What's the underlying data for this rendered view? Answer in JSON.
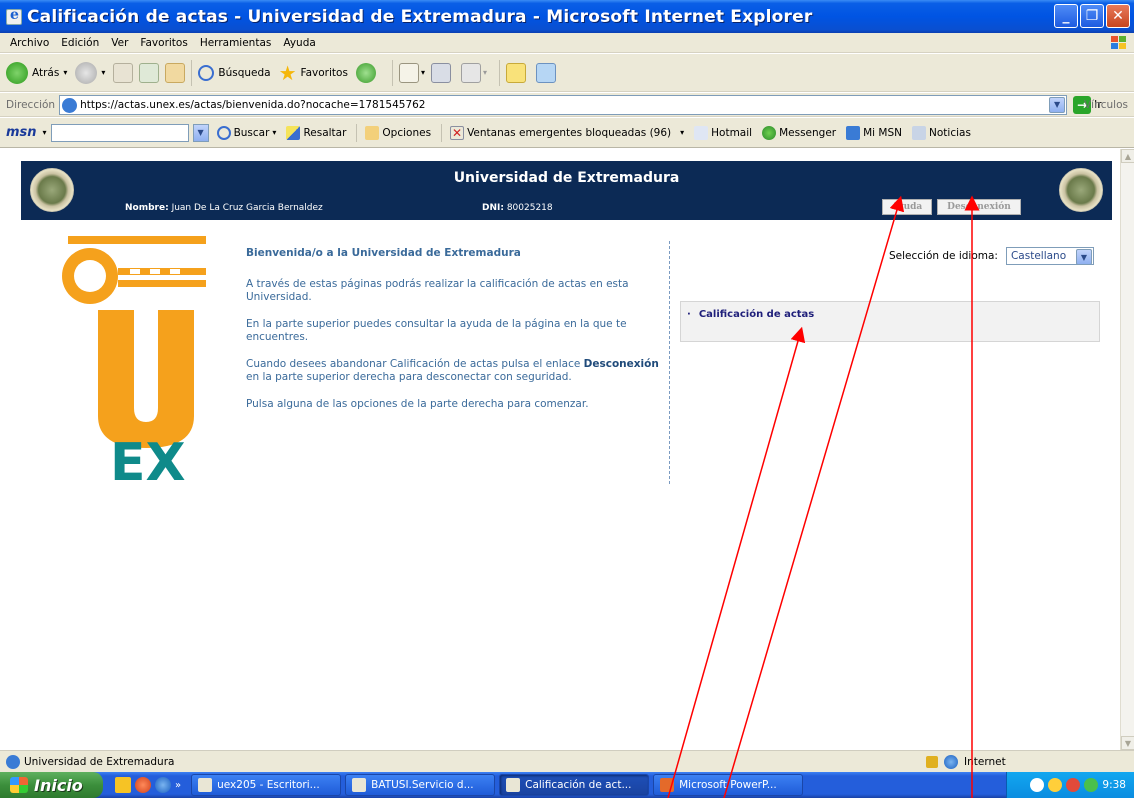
{
  "window": {
    "title": "Calificación de actas - Universidad de Extremadura - Microsoft Internet Explorer"
  },
  "menubar": [
    "Archivo",
    "Edición",
    "Ver",
    "Favoritos",
    "Herramientas",
    "Ayuda"
  ],
  "toolbar": {
    "back": "Atrás",
    "search": "Búsqueda",
    "favorites": "Favoritos"
  },
  "address": {
    "label": "Dirección",
    "url": "https://actas.unex.es/actas/bienvenida.do?nocache=1781545762",
    "go": "Ir",
    "links": "Vínculos"
  },
  "msnbar": {
    "logo": "msn",
    "buscar": "Buscar",
    "resaltar": "Resaltar",
    "opciones": "Opciones",
    "popups": "Ventanas emergentes bloqueadas (96)",
    "hotmail": "Hotmail",
    "messenger": "Messenger",
    "mimsn": "Mi MSN",
    "noticias": "Noticias"
  },
  "page": {
    "header_title": "Universidad de Extremadura",
    "nombre_label": "Nombre:",
    "nombre_value": "Juan De La Cruz Garcia Bernaldez",
    "dni_label": "DNI:",
    "dni_value": "80025218",
    "ayuda": "Ayuda",
    "desconexion": "Desconexión",
    "welcome_title": "Bienvenida/o a la Universidad de Extremadura",
    "p1": "A través de estas páginas podrás realizar la calificación de actas en esta Universidad.",
    "p2": "En la parte superior puedes consultar la ayuda de la página en la que te encuentres.",
    "p3_a": "Cuando desees abandonar Calificación de actas pulsa el enlace ",
    "p3_b": "Desconexión",
    "p3_c": " en la parte superior derecha para desconectar con seguridad.",
    "p4": "Pulsa alguna de las opciones de la parte derecha para comenzar.",
    "lang_label": "Selección de idioma:",
    "lang_value": "Castellano",
    "menu_item": "Calificación de actas",
    "logo_letters": "EX"
  },
  "status": {
    "text": "Universidad de Extremadura",
    "zone": "Internet"
  },
  "taskbar": {
    "start": "Inicio",
    "tasks": [
      "uex205 - Escritori...",
      "BATUSI.Servicio d...",
      "Calificación de act...",
      "Microsoft PowerP..."
    ],
    "time": "9:38"
  },
  "colors": {
    "header_bg": "#0c2a55",
    "logo_orange": "#f5a11c",
    "logo_teal": "#0f8a8a",
    "text_blue": "#3a6a9a",
    "annotation": "#ff0000"
  }
}
